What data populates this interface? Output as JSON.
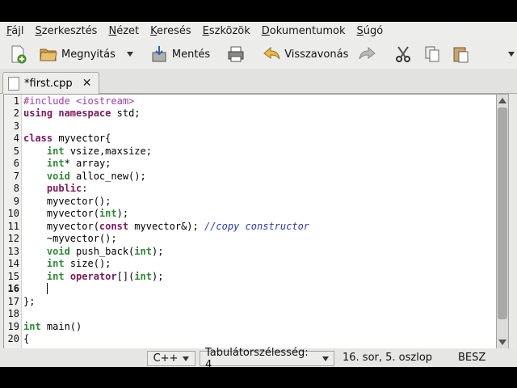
{
  "menubar": {
    "items": [
      {
        "key": "F",
        "rest": "ájl"
      },
      {
        "key": "S",
        "rest": "zerkesztés"
      },
      {
        "key": "N",
        "rest": "ézet"
      },
      {
        "key": "K",
        "rest": "eresés"
      },
      {
        "key": "E",
        "rest": "szközök"
      },
      {
        "key": "D",
        "rest": "okumentumok"
      },
      {
        "key": "S",
        "rest": "úgó"
      }
    ]
  },
  "toolbar": {
    "open_label": "Megnyitás",
    "save_label": "Mentés",
    "undo_label": "Visszavonás"
  },
  "tabs": [
    {
      "label": "*first.cpp"
    }
  ],
  "editor": {
    "current_line": 16,
    "lines": [
      "#include <iostream>",
      "using namespace std;",
      "",
      "class myvector{",
      "    int vsize,maxsize;",
      "    int* array;",
      "    void alloc_new();",
      "    public:",
      "    myvector();",
      "    myvector(int);",
      "    myvector(const myvector&); //copy constructor",
      "    ~myvector();",
      "    void push_back(int);",
      "    int size();",
      "    int operator[](int);",
      "    ",
      "};",
      "",
      "int main()",
      "{"
    ]
  },
  "statusbar": {
    "language": "C++",
    "tab_width": "Tabulátorszélesség: 4",
    "position": "16. sor, 5. oszlop",
    "mode": "BESZ"
  },
  "colors": {
    "keyword": "#7a1a5c",
    "type": "#2d8a36",
    "preprocessor": "#a43aa8",
    "comment": "#2b39bf"
  }
}
